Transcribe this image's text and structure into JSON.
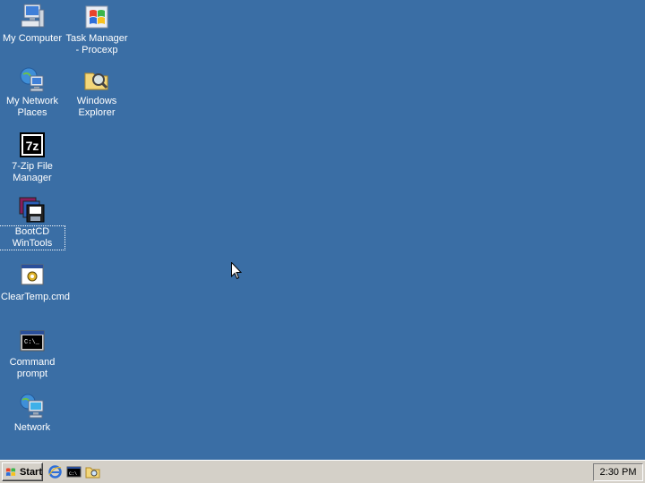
{
  "desktop": {
    "icons": [
      {
        "label": "My Computer"
      },
      {
        "label": "Task Manager - Procexp"
      },
      {
        "label": "My Network Places"
      },
      {
        "label": "Windows Explorer"
      },
      {
        "label": "7-Zip File Manager"
      },
      {
        "label": "BootCD WinTools"
      },
      {
        "label": "ClearTemp.cmd"
      },
      {
        "label": "Command prompt"
      },
      {
        "label": "Network"
      }
    ]
  },
  "taskbar": {
    "start_label": "Start",
    "quick_launch": [
      "internet-explorer-icon",
      "command-prompt-icon",
      "explorer-folder-icon"
    ],
    "clock": "2:30 PM"
  },
  "colors": {
    "desktop_background": "#3A6EA5",
    "taskbar": "#D4D0C8"
  }
}
